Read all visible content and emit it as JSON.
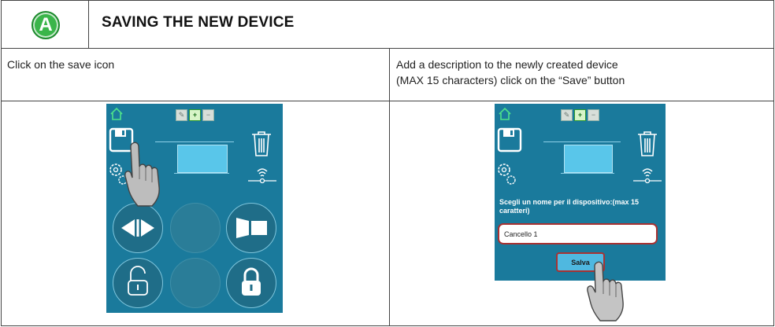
{
  "header": {
    "step_badge": "A",
    "title": "SAVING THE NEW DEVICE"
  },
  "steps": [
    {
      "instruction": "Click on the save icon"
    },
    {
      "instruction_line1": "Add a description to the newly created device",
      "instruction_line2": "(MAX 15 characters) click on the “Save” button"
    }
  ],
  "screen_left": {
    "toolbar": [
      "edit-icon",
      "add-icon",
      "remove-icon"
    ],
    "icons": [
      "home-icon",
      "save-icon",
      "settings-icon",
      "trash-icon",
      "wifi-icon"
    ],
    "buttons": [
      "slide-open-close-icon",
      "gate-icon",
      "unlock-icon",
      "lock-icon"
    ]
  },
  "screen_right": {
    "prompt": "Scegli un nome per il dispositivo:(max 15 caratteri)",
    "input_value": "Cancello 1",
    "save_button": "Salva"
  },
  "colors": {
    "screen_bg": "#1a7a9c",
    "accent_green": "#3ab54a",
    "highlight_red": "#a83232"
  }
}
